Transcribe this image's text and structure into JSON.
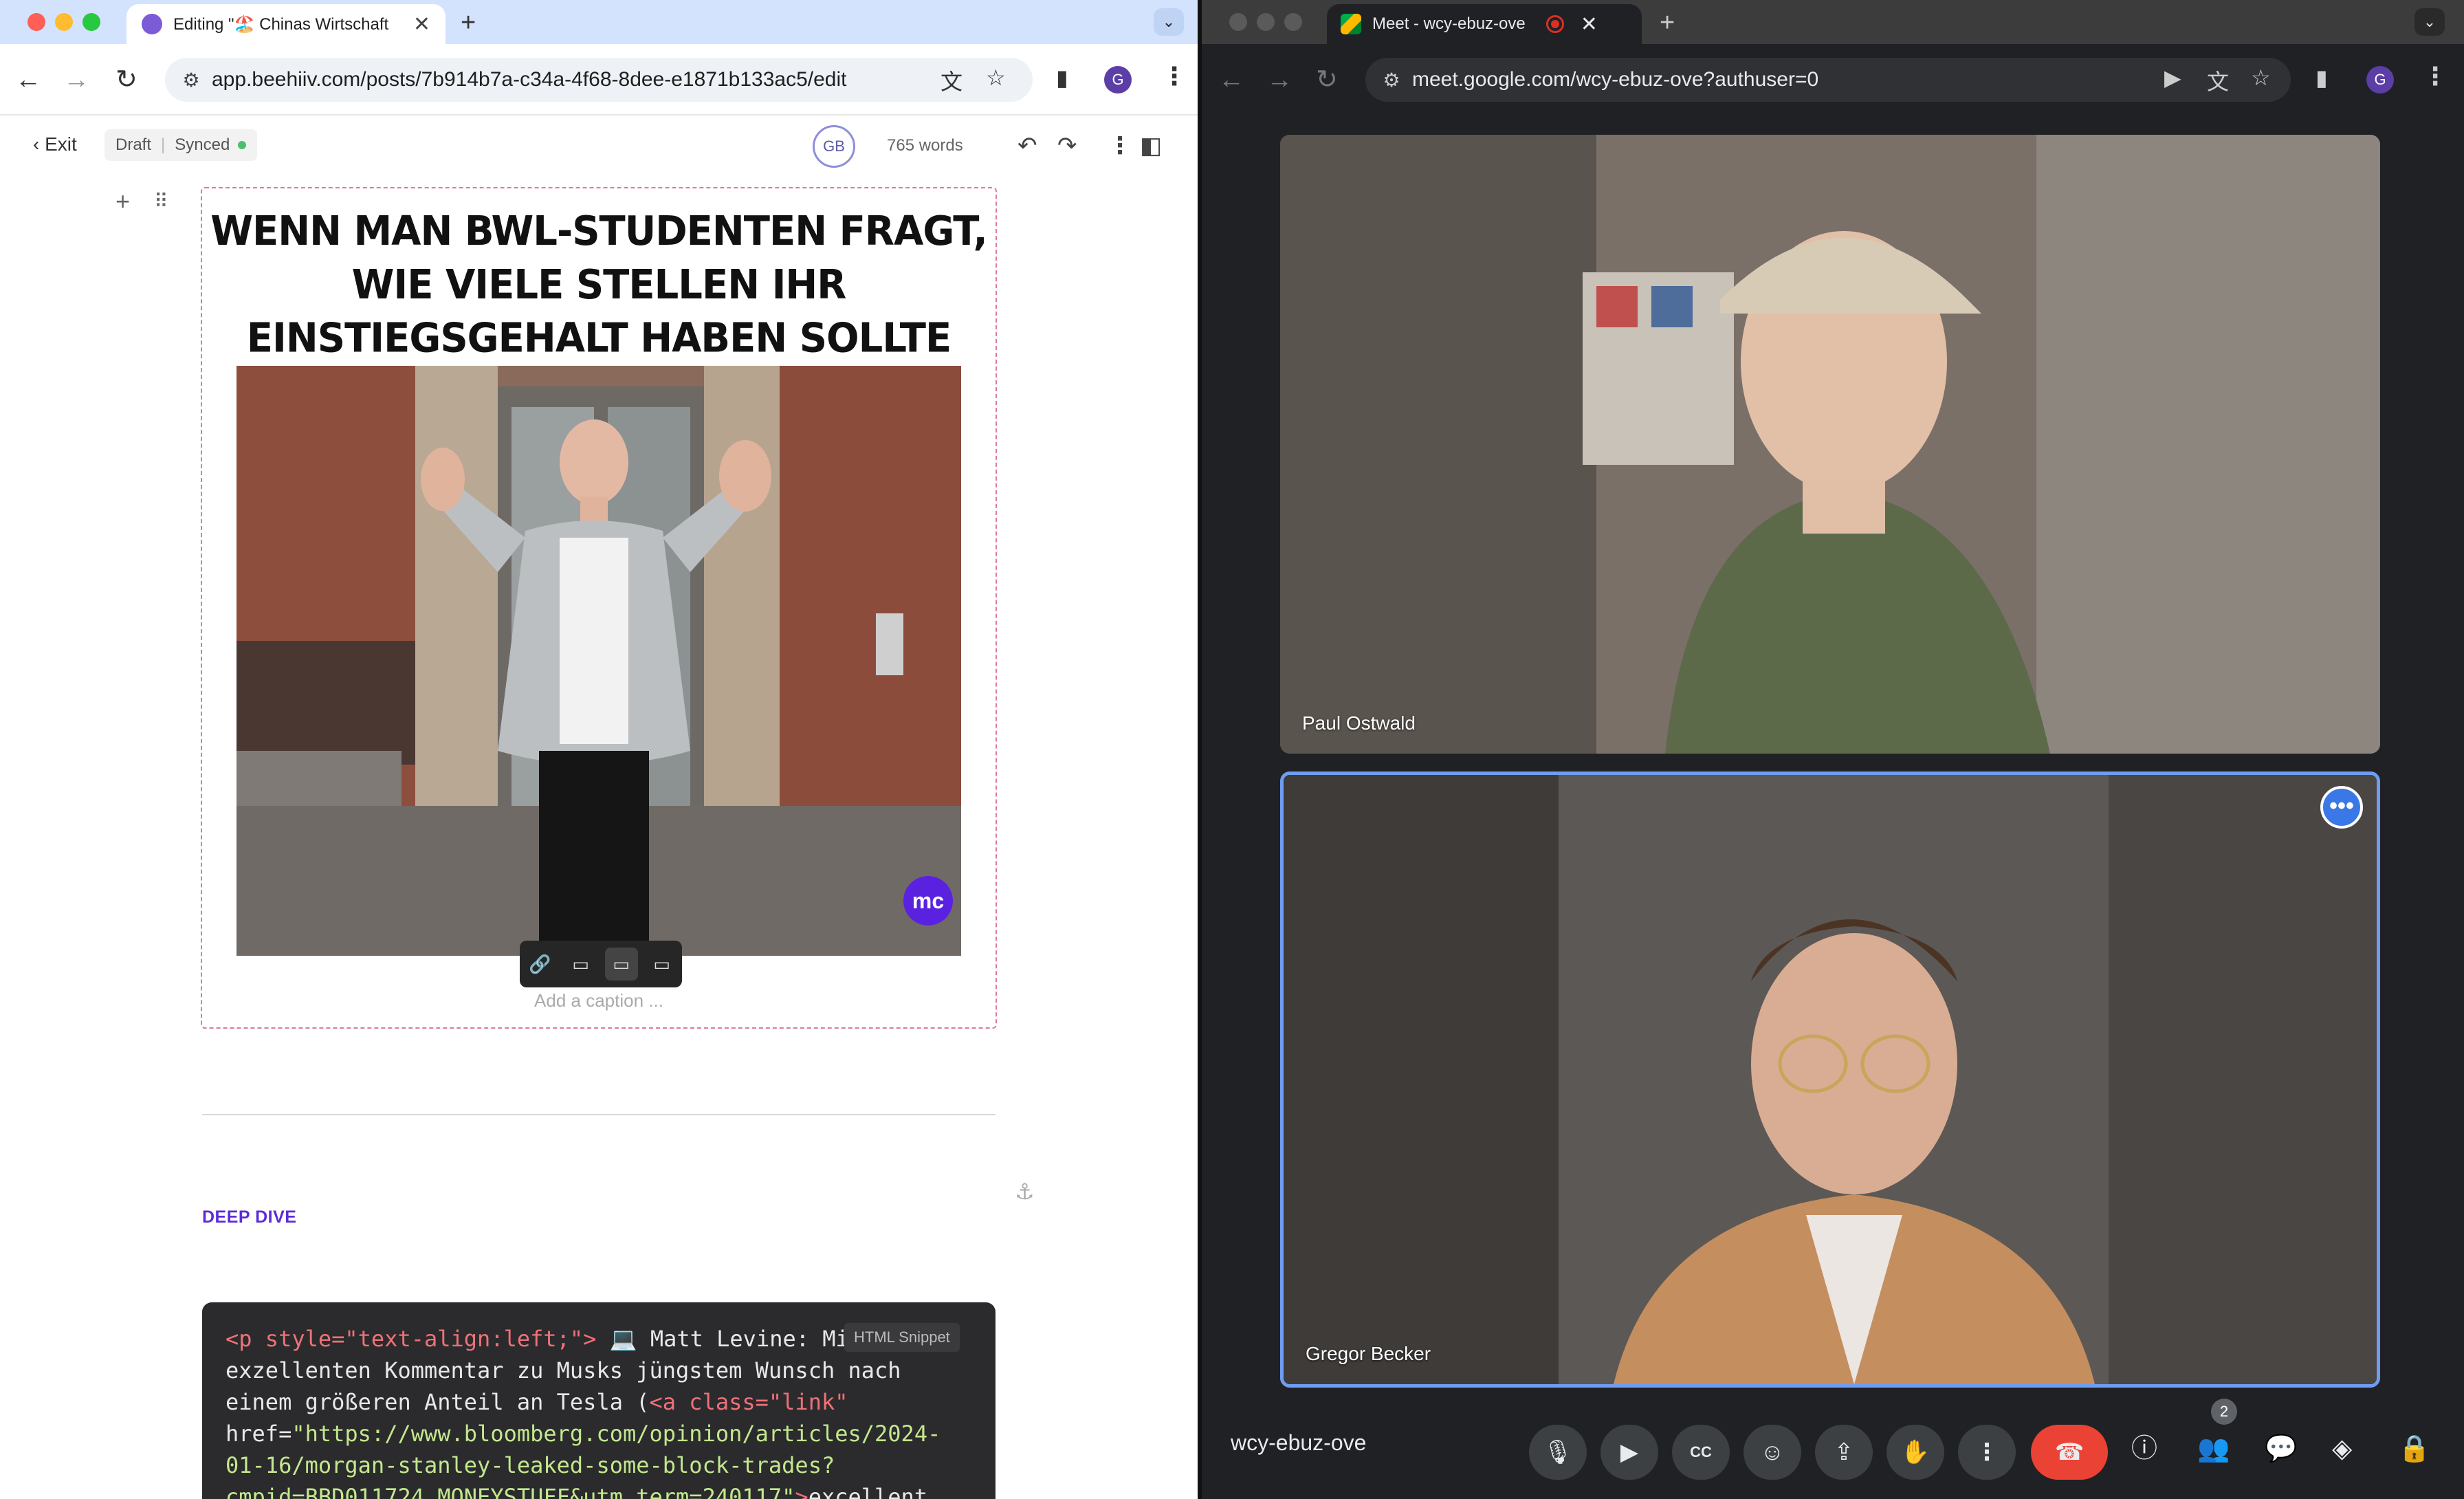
{
  "left_browser": {
    "tab": {
      "title": "Editing \"🏖️ Chinas Wirtschaft",
      "close": "✕"
    },
    "new_tab": "+",
    "tab_menu": "⌄",
    "url": "app.beehiiv.com/posts/7b914b7a-c34a-4f68-8dee-e1871b133ac5/edit",
    "profile_initial": "G"
  },
  "editor": {
    "exit_label": "Exit",
    "status_draft": "Draft",
    "status_synced": "Synced",
    "collaborator_initials": "GB",
    "word_count": "765 words",
    "image_block": {
      "meme_title_lines": [
        "WENN MAN BWL-STUDENTEN FRAGT,",
        "WIE VIELE STELLEN IHR",
        "EINSTIEGSGEHALT HABEN SOLLTE"
      ],
      "watermark": "mc",
      "caption_placeholder": "Add a caption ..."
    },
    "section_label": "DEEP DIVE",
    "html_snippet": {
      "badge": "HTML Snippet",
      "line1_tag": "<p style=\"text-align:left;\">",
      "line1_text": " 💻 Matt Levine: Mi",
      "line2": "exzellenten Kommentar zu Musks jüngstem Wunsch nach",
      "line3_text": "einem größeren Anteil an Tesla (",
      "line3_tag": "<a class=\"link\"",
      "line4_attr": "href=",
      "line4_str": "\"https://www.bloomberg.com/opinion/articles/2024-",
      "line5_str": "01-16/morgan-stanley-leaked-some-block-trades?",
      "line6_str": "cmpid=BBD011724_MONEYSTUFF&utm_term=240117\"",
      "line6_tag": ">",
      "line6_text": "excellent"
    }
  },
  "right_browser": {
    "tab": {
      "title": "Meet - wcy-ebuz-ove",
      "close": "✕"
    },
    "new_tab": "+",
    "tab_menu": "⌄",
    "url": "meet.google.com/wcy-ebuz-ove?authuser=0",
    "profile_initial": "G"
  },
  "meet": {
    "participants": [
      {
        "name": "Paul Ostwald"
      },
      {
        "name": "Gregor Becker"
      }
    ],
    "more_options": "•••",
    "meeting_code": "wcy-ebuz-ove",
    "people_count": "2"
  },
  "colors": {
    "accent_purple": "#5b2dd6",
    "meet_end_call": "#ea4335",
    "meet_active_border": "#6e9df2",
    "synced_dot": "#4cc06a"
  }
}
